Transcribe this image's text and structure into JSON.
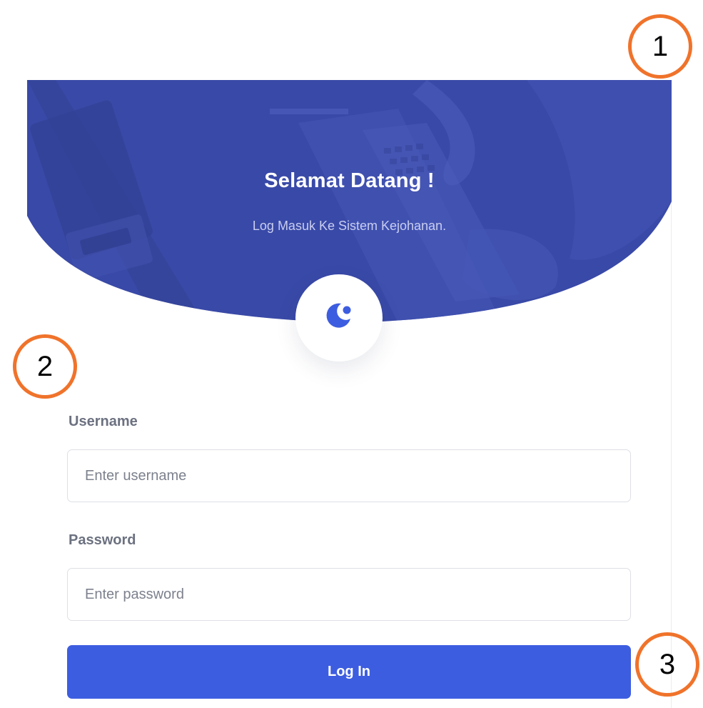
{
  "hero": {
    "title": "Selamat Datang !",
    "subtitle": "Log Masuk Ke Sistem Kejohanan."
  },
  "logo": {
    "icon": "logo-icon",
    "color": "#3d5de0"
  },
  "form": {
    "username": {
      "label": "Username",
      "value": "",
      "placeholder": "Enter username"
    },
    "password": {
      "label": "Password",
      "value": "",
      "placeholder": "Enter password"
    },
    "login_label": "Log In"
  },
  "annotations": [
    "1",
    "2",
    "3"
  ],
  "colors": {
    "hero_overlay": "#3d4aa3",
    "primary": "#3d5de0",
    "annotation_ring": "#f0732b"
  }
}
